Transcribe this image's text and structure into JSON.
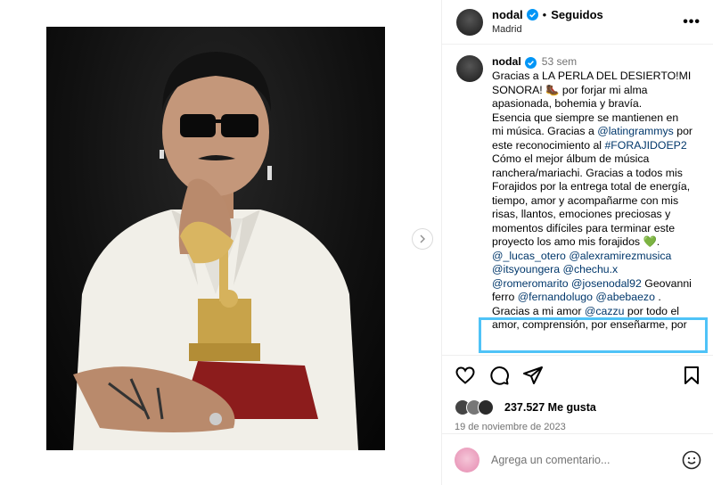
{
  "post": {
    "username": "nodal",
    "follow_status": "Seguidos",
    "location": "Madrid",
    "more_icon": "•••"
  },
  "caption": {
    "username": "nodal",
    "time": "53 sem",
    "lines": [
      [
        {
          "t": "Gracias a LA PERLA DEL DESIERTO!MI"
        }
      ],
      [
        {
          "t": "SONORA! 🥾 por forjar mi alma"
        }
      ],
      [
        {
          "t": "apasionada, bohemia y bravía."
        }
      ],
      [
        {
          "t": "Esencia que siempre se mantienen en"
        }
      ],
      [
        {
          "t": "mi música. Gracias a "
        },
        {
          "t": "@latingrammys",
          "m": true
        },
        {
          "t": " por"
        }
      ],
      [
        {
          "t": "este reconocimiento al "
        },
        {
          "t": "#FORAJIDOEP2",
          "m": true
        }
      ],
      [
        {
          "t": "Cómo el mejor álbum de música"
        }
      ],
      [
        {
          "t": "ranchera/mariachi. Gracias a todos mis"
        }
      ],
      [
        {
          "t": "Forajidos por la entrega total de energía,"
        }
      ],
      [
        {
          "t": "tiempo, amor y acompañarme con mis"
        }
      ],
      [
        {
          "t": "risas, llantos, emociones preciosas y"
        }
      ],
      [
        {
          "t": "momentos difíciles para terminar este"
        }
      ],
      [
        {
          "t": "proyecto los amo mis forajidos 💚."
        }
      ],
      [
        {
          "t": "@_lucas_otero",
          "m": true
        },
        {
          "t": " "
        },
        {
          "t": "@alexramirezmusica",
          "m": true
        }
      ],
      [
        {
          "t": "@itsyoungera",
          "m": true
        },
        {
          "t": " "
        },
        {
          "t": "@chechu.x",
          "m": true
        }
      ],
      [
        {
          "t": "@romeromarito",
          "m": true
        },
        {
          "t": " "
        },
        {
          "t": "@josenodal92",
          "m": true
        },
        {
          "t": " Geovanni"
        }
      ],
      [
        {
          "t": "ferro "
        },
        {
          "t": "@fernandolugo",
          "m": true
        },
        {
          "t": " "
        },
        {
          "t": "@abebaezo",
          "m": true
        },
        {
          "t": " ."
        }
      ],
      [
        {
          "t": "Gracias a mi amor "
        },
        {
          "t": "@cazzu",
          "m": true
        },
        {
          "t": " por todo el"
        }
      ],
      [
        {
          "t": "amor, comprensión, por enseñarme, por"
        }
      ]
    ]
  },
  "actions": {
    "like_icon": "heart-icon",
    "comment_icon": "comment-icon",
    "share_icon": "share-icon",
    "save_icon": "bookmark-icon"
  },
  "likes_text": "237.527 Me gusta",
  "date": "19 de noviembre de 2023",
  "comment": {
    "placeholder": "Agrega un comentario...",
    "emoji_icon": "emoji-icon"
  },
  "colors": {
    "verified": "#0095f6",
    "mention": "#00376b",
    "highlight": "#4fc3f7"
  }
}
